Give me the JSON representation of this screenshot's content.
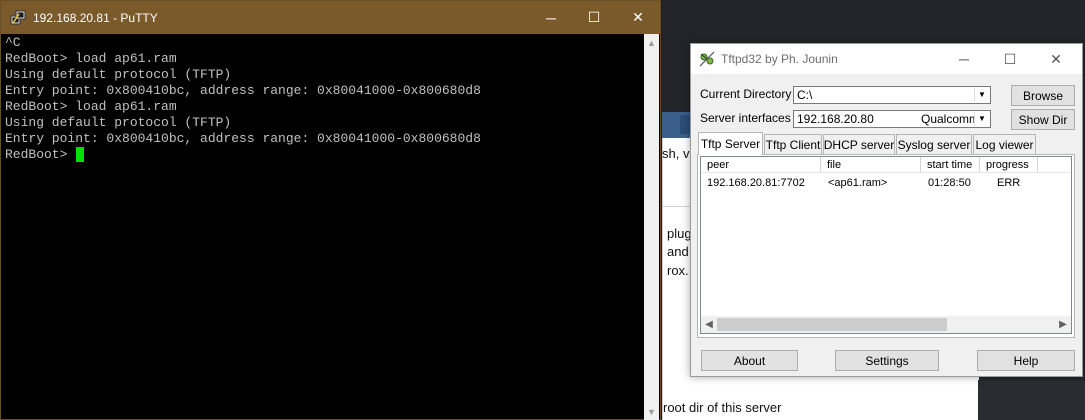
{
  "background_page": {
    "fragments": [
      "sh, v",
      "plug",
      "and",
      "rox.",
      "root dir of this server"
    ]
  },
  "putty": {
    "title": "192.168.20.81 - PuTTY",
    "caption_buttons": {
      "minimize": "─",
      "maximize": "☐",
      "close": "✕"
    },
    "terminal_lines": [
      "^C",
      "RedBoot> load ap61.ram",
      "Using default protocol (TFTP)",
      "Entry point: 0x800410bc, address range: 0x80041000-0x800680d8",
      "RedBoot> load ap61.ram",
      "Using default protocol (TFTP)",
      "Entry point: 0x800410bc, address range: 0x80041000-0x800680d8"
    ],
    "prompt": "RedBoot> ",
    "colors": {
      "titlebar": "#7a5a2b",
      "cursor": "#00e000",
      "text": "#c0c0c0"
    }
  },
  "tftpd": {
    "title": "Tftpd32 by Ph. Jounin",
    "caption_buttons": {
      "minimize": "─",
      "maximize": "☐",
      "close": "✕"
    },
    "current_directory_label": "Current Directory",
    "current_directory_value": "C:\\",
    "server_interfaces_label": "Server interfaces",
    "server_interface_ip": "192.168.20.80",
    "server_interface_name": "Qualcomm",
    "browse_label": "Browse",
    "show_dir_label": "Show Dir",
    "tabs": [
      {
        "label": "Tftp Server",
        "active": true
      },
      {
        "label": "Tftp Client",
        "active": false
      },
      {
        "label": "DHCP server",
        "active": false
      },
      {
        "label": "Syslog server",
        "active": false
      },
      {
        "label": "Log viewer",
        "active": false
      }
    ],
    "columns": [
      "peer",
      "file",
      "start time",
      "progress"
    ],
    "rows": [
      {
        "peer": "192.168.20.81:7702",
        "file": "<ap61.ram>",
        "start_time": "01:28:50",
        "progress": "ERR"
      }
    ],
    "about_label": "About",
    "settings_label": "Settings",
    "help_label": "Help"
  }
}
